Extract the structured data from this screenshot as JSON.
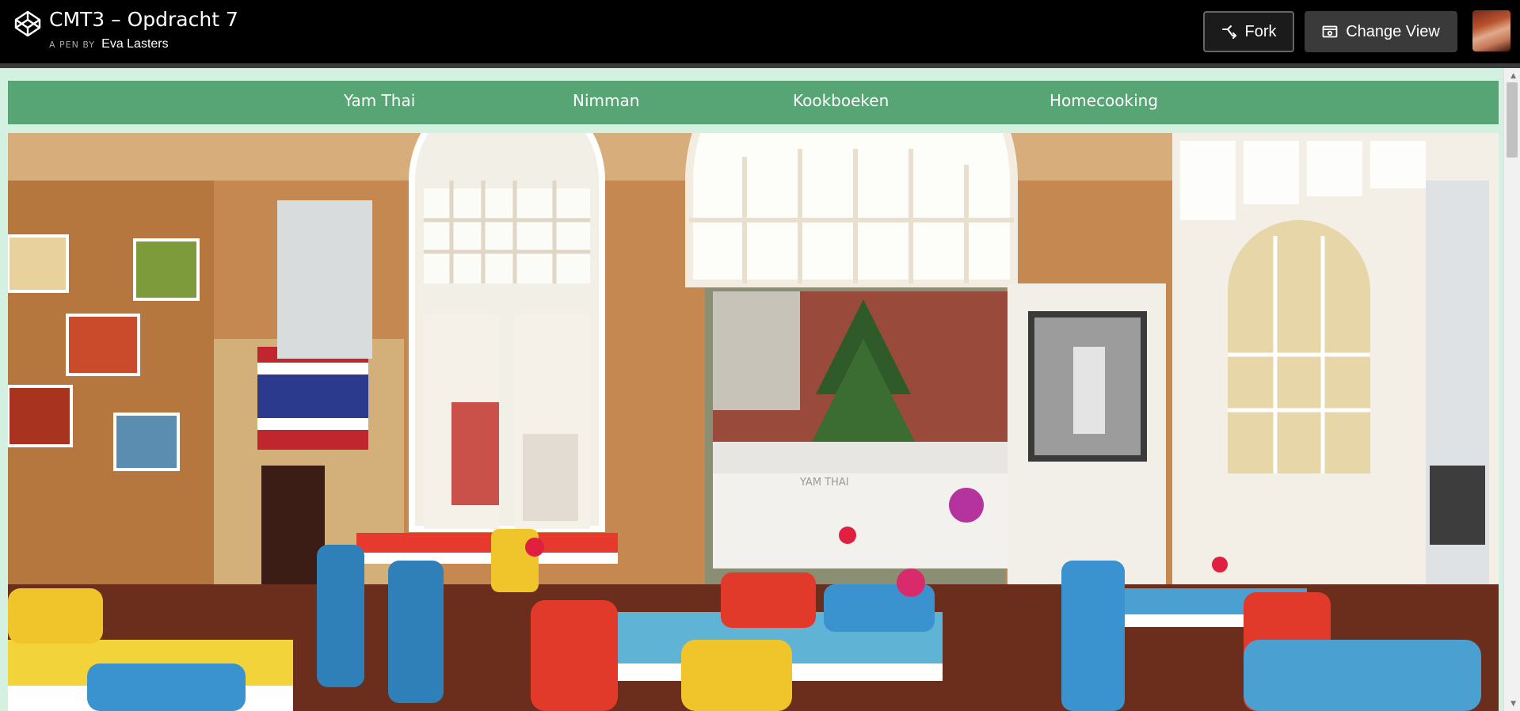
{
  "header": {
    "title": "CMT3 – Opdracht 7",
    "byline_prefix": "A PEN BY",
    "author": "Eva Lasters",
    "fork_label": "Fork",
    "change_view_label": "Change View"
  },
  "nav": {
    "items": [
      {
        "label": "Yam Thai"
      },
      {
        "label": "Nimman"
      },
      {
        "label": "Kookboeken"
      },
      {
        "label": "Homecooking"
      }
    ]
  },
  "hero": {
    "window_sign": "YAM THAI"
  },
  "colors": {
    "page_bg": "#d4f0e1",
    "nav_bg": "#57a574",
    "header_bg": "#000000"
  },
  "icons": {
    "logo": "codepen-logo-icon",
    "fork": "fork-icon",
    "change_view": "change-view-icon"
  }
}
